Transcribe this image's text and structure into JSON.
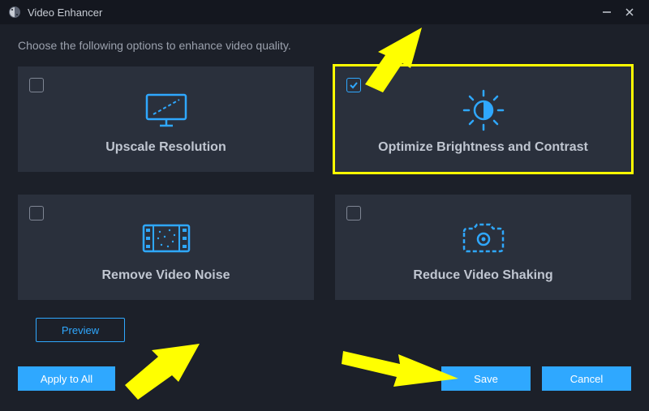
{
  "titlebar": {
    "title": "Video Enhancer"
  },
  "instruction": "Choose the following options to enhance video quality.",
  "options": {
    "upscale": {
      "label": "Upscale Resolution",
      "checked": false
    },
    "brightness": {
      "label": "Optimize Brightness and Contrast",
      "checked": true
    },
    "noise": {
      "label": "Remove Video Noise",
      "checked": false
    },
    "shake": {
      "label": "Reduce Video Shaking",
      "checked": false
    }
  },
  "buttons": {
    "preview": "Preview",
    "apply": "Apply to All",
    "save": "Save",
    "cancel": "Cancel"
  },
  "colors": {
    "accent": "#2fa8ff",
    "highlight": "yellow"
  }
}
